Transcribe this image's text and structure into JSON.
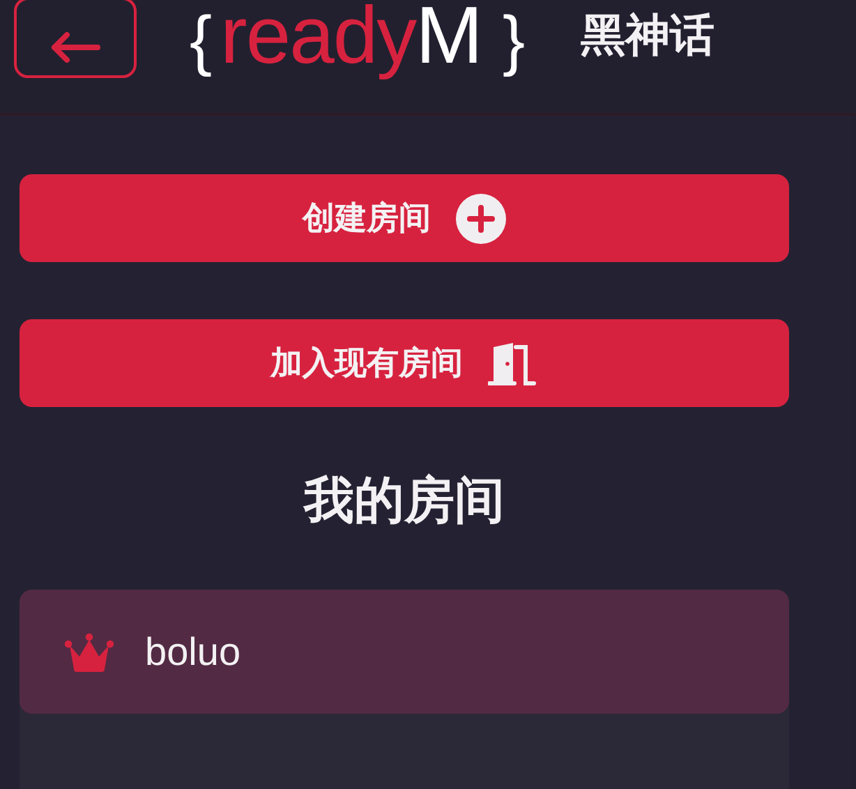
{
  "header": {
    "logo": {
      "open_brace": "{",
      "word": "ready",
      "letter": "M",
      "close_brace": "}"
    },
    "title": "黑神话"
  },
  "actions": [
    {
      "label": "创建房间",
      "kind": "create"
    },
    {
      "label": "加入现有房间",
      "kind": "join"
    }
  ],
  "rooms_heading": "我的房间",
  "rooms": [
    {
      "name": "boluo",
      "owner": true
    }
  ]
}
